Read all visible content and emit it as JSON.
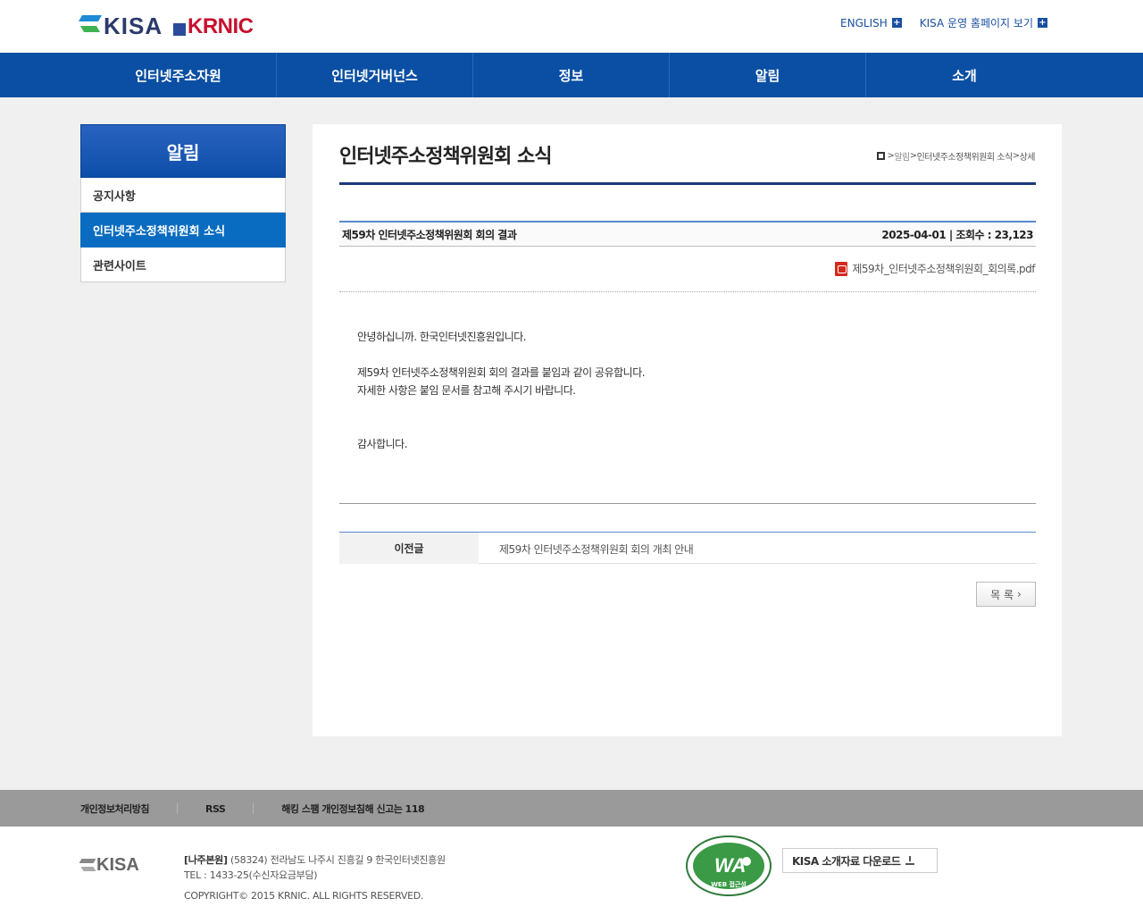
{
  "header": {
    "logo_kisa": "KISA",
    "logo_krnic": "KRNIC",
    "links": [
      {
        "label": "ENGLISH"
      },
      {
        "label": "KISA 운영 홈페이지 보기"
      }
    ]
  },
  "nav": {
    "items": [
      {
        "label": "인터넷주소자원"
      },
      {
        "label": "인터넷거버넌스"
      },
      {
        "label": "정보"
      },
      {
        "label": "알림"
      },
      {
        "label": "소개"
      }
    ]
  },
  "sidebar": {
    "title": "알림",
    "items": [
      {
        "label": "공지사항"
      },
      {
        "label": "인터넷주소정책위원회 소식"
      },
      {
        "label": "관련사이트"
      }
    ]
  },
  "page": {
    "title": "인터넷주소정책위원회 소식",
    "breadcrumb": {
      "sep1": ">",
      "level1": "알림",
      "sep2": ">",
      "level2": "인터넷주소정책위원회 소식",
      "sep3": ">",
      "level3": "상세"
    }
  },
  "post": {
    "title": "제59차 인터넷주소정책위원회 회의 결과",
    "meta": "2025-04-01 | 조회수 : 23,123",
    "attachment": "제59차_인터넷주소정책위원회_회의록.pdf",
    "body": [
      "안녕하십니까. 한국인터넷진흥원입니다.",
      "",
      "제59차 인터넷주소정책위원회 회의 결과를 붙임과 같이 공유합니다.",
      "자세한 사항은 붙임 문서를 참고해 주시기 바랍니다.",
      "",
      "",
      "감사합니다."
    ],
    "prev_label": "이전글",
    "prev_title": "제59차 인터넷주소정책위원회 회의 개최 안내",
    "list_button": "목 록",
    "list_arrow": "›"
  },
  "footer": {
    "links": [
      {
        "label": "개인정보처리방침"
      },
      {
        "label": "RSS"
      },
      {
        "label": "해킹 스팸 개인정보침해 신고는 118"
      }
    ],
    "logo": "KISA",
    "address_label": "[나주본원]",
    "address": "(58324) 전라남도 나주시 진흥길 9 한국인터넷진흥원",
    "tel": "TEL : 1433-25(수신자요금부담)",
    "copyright": "COPYRIGHT© 2015 KRNIC. ALL RIGHTS RESERVED.",
    "badge_text": "WA",
    "badge_sub": "WEB 접근성",
    "download_label": "KISA 소개자료 다운로드"
  },
  "colors": {
    "nav_bg": "#0a4fa3",
    "sidebar_active": "#0a6cc0",
    "accent_line": "#5a88cf",
    "kisa_red": "#c8102e"
  }
}
